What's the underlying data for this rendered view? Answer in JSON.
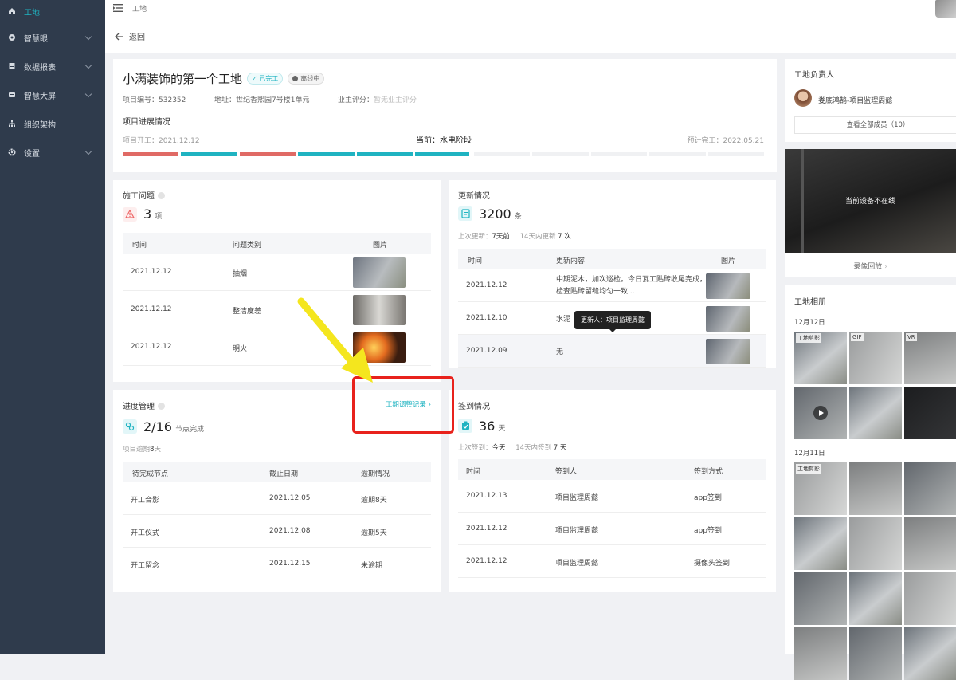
{
  "sidebar": {
    "items": [
      {
        "label": "工地",
        "icon": "home-icon"
      },
      {
        "label": "智慧眼",
        "icon": "eye-icon"
      },
      {
        "label": "数据报表",
        "icon": "report-icon"
      },
      {
        "label": "智慧大屏",
        "icon": "screen-icon"
      },
      {
        "label": "组织架构",
        "icon": "org-icon"
      },
      {
        "label": "设置",
        "icon": "gear-icon"
      }
    ],
    "accent": "#1fb3c1"
  },
  "topbar": {
    "crumb": "工地",
    "back": "返回"
  },
  "project": {
    "name": "小满装饰的第一个工地",
    "tag_done": "已完工",
    "tag_offline": "离线中",
    "code_label": "项目编号：",
    "code": "532352",
    "address_label": "地址：",
    "address": "世纪香熙园7号楼1单元",
    "rating_label": "业主评分：",
    "rating": "暂无业主评分",
    "progress_title": "项目进展情况",
    "start_label": "项目开工：",
    "start": "2021.12.12",
    "current_label": "当前：",
    "current": "水电阶段",
    "expected_label": "预计完工：",
    "expected": "2022.05.21",
    "stage_states": [
      "late",
      "done",
      "late",
      "done",
      "done",
      "active",
      "todo",
      "todo",
      "todo",
      "todo",
      "todo"
    ]
  },
  "issues": {
    "title": "施工问题",
    "count": "3",
    "unit": "项",
    "headers": [
      "时间",
      "问题类别",
      "图片"
    ],
    "rows": [
      {
        "time": "2021.12.12",
        "type": "抽烟"
      },
      {
        "time": "2021.12.12",
        "type": "整洁度差"
      },
      {
        "time": "2021.12.12",
        "type": "明火"
      }
    ]
  },
  "updates": {
    "title": "更新情况",
    "count": "3200",
    "unit": "条",
    "last_label": "上次更新：",
    "last": "7天前",
    "recent_label": "14天内更新",
    "recent": "7",
    "recent_unit": "次",
    "headers": [
      "时间",
      "更新内容",
      "图片"
    ],
    "rows": [
      {
        "time": "2021.12.12",
        "content": "中期泥木，加次巡检。今日瓦工贴砖收尾完成，检查贴砖留缝均匀一致..."
      },
      {
        "time": "2021.12.10",
        "content": "水泥"
      },
      {
        "time": "2021.12.09",
        "content": "无"
      }
    ],
    "tooltip": "更新人：项目监理周懿"
  },
  "schedule": {
    "title": "进度管理",
    "link": "工期调整记录",
    "count": "2/16",
    "unit": "节点完成",
    "overdue_label": "项目逾期",
    "overdue": "8",
    "overdue_unit": "天",
    "headers": [
      "待完成节点",
      "截止日期",
      "逾期情况"
    ],
    "rows": [
      {
        "node": "开工合影",
        "date": "2021.12.05",
        "status": "逾期8天"
      },
      {
        "node": "开工仪式",
        "date": "2021.12.08",
        "status": "逾期5天"
      },
      {
        "node": "开工留念",
        "date": "2021.12.15",
        "status": "未逾期"
      }
    ]
  },
  "checkin": {
    "title": "签到情况",
    "count": "36",
    "unit": "天",
    "last_label": "上次签到：",
    "last": "今天",
    "recent_label": "14天内签到",
    "recent": "7",
    "recent_unit": "天",
    "headers": [
      "时间",
      "签到人",
      "签到方式"
    ],
    "rows": [
      {
        "time": "2021.12.13",
        "person": "项目监理周懿",
        "method": "app签到"
      },
      {
        "time": "2021.12.12",
        "person": "项目监理周懿",
        "method": "app签到"
      },
      {
        "time": "2021.12.12",
        "person": "项目监理周懿",
        "method": "摄像头签到"
      }
    ]
  },
  "manager": {
    "title": "工地负责人",
    "person": "娄底鸿鹄-项目监理周懿",
    "all_members": "查看全部成员（10）"
  },
  "camera": {
    "status": "当前设备不在线",
    "replay": "录像回放"
  },
  "album": {
    "title": "工地相册",
    "day1": "12月12日",
    "day2": "12月11日",
    "labels": [
      "工地剪影",
      "GIF",
      "VR",
      "工地剪影"
    ]
  }
}
